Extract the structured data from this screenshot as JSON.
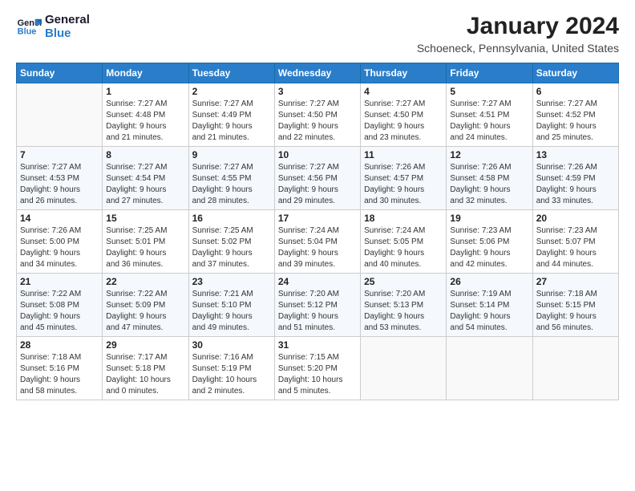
{
  "logo": {
    "line1": "General",
    "line2": "Blue"
  },
  "title": "January 2024",
  "location": "Schoeneck, Pennsylvania, United States",
  "days_header": [
    "Sunday",
    "Monday",
    "Tuesday",
    "Wednesday",
    "Thursday",
    "Friday",
    "Saturday"
  ],
  "weeks": [
    [
      {
        "num": "",
        "info": ""
      },
      {
        "num": "1",
        "info": "Sunrise: 7:27 AM\nSunset: 4:48 PM\nDaylight: 9 hours\nand 21 minutes."
      },
      {
        "num": "2",
        "info": "Sunrise: 7:27 AM\nSunset: 4:49 PM\nDaylight: 9 hours\nand 21 minutes."
      },
      {
        "num": "3",
        "info": "Sunrise: 7:27 AM\nSunset: 4:50 PM\nDaylight: 9 hours\nand 22 minutes."
      },
      {
        "num": "4",
        "info": "Sunrise: 7:27 AM\nSunset: 4:50 PM\nDaylight: 9 hours\nand 23 minutes."
      },
      {
        "num": "5",
        "info": "Sunrise: 7:27 AM\nSunset: 4:51 PM\nDaylight: 9 hours\nand 24 minutes."
      },
      {
        "num": "6",
        "info": "Sunrise: 7:27 AM\nSunset: 4:52 PM\nDaylight: 9 hours\nand 25 minutes."
      }
    ],
    [
      {
        "num": "7",
        "info": "Sunrise: 7:27 AM\nSunset: 4:53 PM\nDaylight: 9 hours\nand 26 minutes."
      },
      {
        "num": "8",
        "info": "Sunrise: 7:27 AM\nSunset: 4:54 PM\nDaylight: 9 hours\nand 27 minutes."
      },
      {
        "num": "9",
        "info": "Sunrise: 7:27 AM\nSunset: 4:55 PM\nDaylight: 9 hours\nand 28 minutes."
      },
      {
        "num": "10",
        "info": "Sunrise: 7:27 AM\nSunset: 4:56 PM\nDaylight: 9 hours\nand 29 minutes."
      },
      {
        "num": "11",
        "info": "Sunrise: 7:26 AM\nSunset: 4:57 PM\nDaylight: 9 hours\nand 30 minutes."
      },
      {
        "num": "12",
        "info": "Sunrise: 7:26 AM\nSunset: 4:58 PM\nDaylight: 9 hours\nand 32 minutes."
      },
      {
        "num": "13",
        "info": "Sunrise: 7:26 AM\nSunset: 4:59 PM\nDaylight: 9 hours\nand 33 minutes."
      }
    ],
    [
      {
        "num": "14",
        "info": "Sunrise: 7:26 AM\nSunset: 5:00 PM\nDaylight: 9 hours\nand 34 minutes."
      },
      {
        "num": "15",
        "info": "Sunrise: 7:25 AM\nSunset: 5:01 PM\nDaylight: 9 hours\nand 36 minutes."
      },
      {
        "num": "16",
        "info": "Sunrise: 7:25 AM\nSunset: 5:02 PM\nDaylight: 9 hours\nand 37 minutes."
      },
      {
        "num": "17",
        "info": "Sunrise: 7:24 AM\nSunset: 5:04 PM\nDaylight: 9 hours\nand 39 minutes."
      },
      {
        "num": "18",
        "info": "Sunrise: 7:24 AM\nSunset: 5:05 PM\nDaylight: 9 hours\nand 40 minutes."
      },
      {
        "num": "19",
        "info": "Sunrise: 7:23 AM\nSunset: 5:06 PM\nDaylight: 9 hours\nand 42 minutes."
      },
      {
        "num": "20",
        "info": "Sunrise: 7:23 AM\nSunset: 5:07 PM\nDaylight: 9 hours\nand 44 minutes."
      }
    ],
    [
      {
        "num": "21",
        "info": "Sunrise: 7:22 AM\nSunset: 5:08 PM\nDaylight: 9 hours\nand 45 minutes."
      },
      {
        "num": "22",
        "info": "Sunrise: 7:22 AM\nSunset: 5:09 PM\nDaylight: 9 hours\nand 47 minutes."
      },
      {
        "num": "23",
        "info": "Sunrise: 7:21 AM\nSunset: 5:10 PM\nDaylight: 9 hours\nand 49 minutes."
      },
      {
        "num": "24",
        "info": "Sunrise: 7:20 AM\nSunset: 5:12 PM\nDaylight: 9 hours\nand 51 minutes."
      },
      {
        "num": "25",
        "info": "Sunrise: 7:20 AM\nSunset: 5:13 PM\nDaylight: 9 hours\nand 53 minutes."
      },
      {
        "num": "26",
        "info": "Sunrise: 7:19 AM\nSunset: 5:14 PM\nDaylight: 9 hours\nand 54 minutes."
      },
      {
        "num": "27",
        "info": "Sunrise: 7:18 AM\nSunset: 5:15 PM\nDaylight: 9 hours\nand 56 minutes."
      }
    ],
    [
      {
        "num": "28",
        "info": "Sunrise: 7:18 AM\nSunset: 5:16 PM\nDaylight: 9 hours\nand 58 minutes."
      },
      {
        "num": "29",
        "info": "Sunrise: 7:17 AM\nSunset: 5:18 PM\nDaylight: 10 hours\nand 0 minutes."
      },
      {
        "num": "30",
        "info": "Sunrise: 7:16 AM\nSunset: 5:19 PM\nDaylight: 10 hours\nand 2 minutes."
      },
      {
        "num": "31",
        "info": "Sunrise: 7:15 AM\nSunset: 5:20 PM\nDaylight: 10 hours\nand 5 minutes."
      },
      {
        "num": "",
        "info": ""
      },
      {
        "num": "",
        "info": ""
      },
      {
        "num": "",
        "info": ""
      }
    ]
  ]
}
